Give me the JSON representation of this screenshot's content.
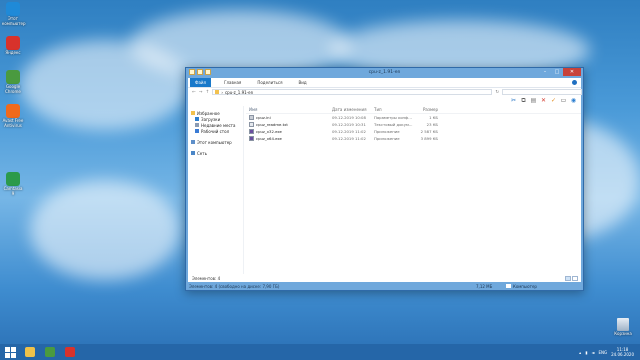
{
  "desktop": {
    "icons": [
      {
        "label": "Этот компьютер",
        "icon": "computer-icon",
        "color": "#1f8ad8"
      },
      {
        "label": "Яндекс",
        "icon": "yandex-icon",
        "color": "#d8322b"
      },
      {
        "label": "Google Chrome",
        "icon": "chrome-icon",
        "color": "#4a9a3f"
      },
      {
        "label": "Avast Free Antivirus",
        "icon": "avast-icon",
        "color": "#f06a1c"
      },
      {
        "label": "Camtasia 9",
        "icon": "camtasia-icon",
        "color": "#2c9a4b"
      }
    ],
    "recycle_bin": "Корзина"
  },
  "window": {
    "title": "cpu-z_1.91-en",
    "ribbon_tabs": [
      "Файл",
      "Главная",
      "Поделиться",
      "Вид"
    ],
    "address": "cpu-z_1.91-en",
    "breadcrumb_sep": "›",
    "nav": [
      {
        "label": "Избранное",
        "icon": "star-icon",
        "color": "#f2c14e"
      },
      {
        "label": "Загрузки",
        "icon": "download-folder-icon",
        "color": "#2d7fd0"
      },
      {
        "label": "Недавние места",
        "icon": "recent-places-icon",
        "color": "#8a9bb3"
      },
      {
        "label": "Рабочий стол",
        "icon": "desktop-folder-icon",
        "color": "#3a7bd5"
      },
      {
        "label": "Этот компьютер",
        "icon": "computer-icon",
        "color": "#5e8fc9"
      },
      {
        "label": "Сеть",
        "icon": "network-icon",
        "color": "#4b86c7"
      }
    ],
    "columns": {
      "name": "Имя",
      "date": "Дата изменения",
      "type": "Тип",
      "size": "Размер"
    },
    "files": [
      {
        "name": "cpuz.ini",
        "date": "09.12.2019 10:08",
        "type": "Параметры конф...",
        "size": "1 КБ",
        "icon": "ini-file-icon"
      },
      {
        "name": "cpuz_readme.txt",
        "date": "09.12.2019 10:31",
        "type": "Текстовый докум...",
        "size": "23 КБ",
        "icon": "text-file-icon"
      },
      {
        "name": "cpuz_x32.exe",
        "date": "09.12.2019 11:02",
        "type": "Приложение",
        "size": "2 587 КБ",
        "icon": "cpuz-exe-icon"
      },
      {
        "name": "cpuz_x64.exe",
        "date": "09.12.2019 11:02",
        "type": "Приложение",
        "size": "3 899 КБ",
        "icon": "cpuz-exe-icon"
      }
    ],
    "status_items": "Элементов: 4",
    "status_bottom": "Элементов: 4 (свободно на диске: 7,90 ГБ)",
    "status_size": "7,12 МБ",
    "status_location": "Компьютер"
  },
  "taskbar": {
    "apps": [
      {
        "name": "explorer-taskbar-icon",
        "color": "#f0c24a"
      },
      {
        "name": "chrome-taskbar-icon",
        "color": "#4a9a3f"
      },
      {
        "name": "camtasia-taskbar-icon",
        "color": "#d8322b"
      }
    ],
    "lang": "ENG",
    "time": "11:18",
    "date": "24.06.2020"
  }
}
